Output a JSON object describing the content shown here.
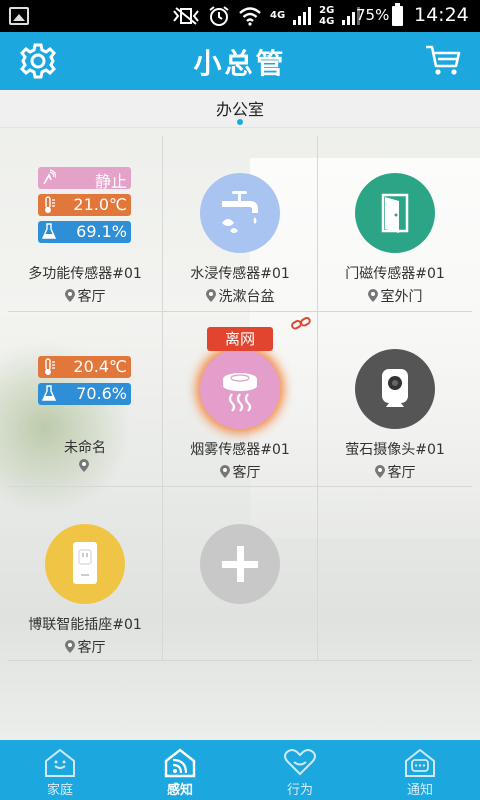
{
  "statusbar": {
    "network_top": "4G",
    "network_bottom": "4G",
    "network2_top": "2G",
    "battery": "75%",
    "time": "14:24"
  },
  "header": {
    "title": "小总管"
  },
  "room": {
    "name": "办公室"
  },
  "devices": [
    {
      "name": "多功能传感器#01",
      "location": "客厅",
      "readings": {
        "motion": "静止",
        "temperature": "21.0℃",
        "humidity": "69.1%"
      }
    },
    {
      "name": "水浸传感器#01",
      "location": "洗漱台盆",
      "icon": "water-faucet-icon",
      "color": "#a9c4f0"
    },
    {
      "name": "门磁传感器#01",
      "location": "室外门",
      "icon": "door-icon",
      "color": "#2ba585"
    },
    {
      "name": "未命名",
      "location": "",
      "readings": {
        "temperature": "20.4℃",
        "humidity": "70.6%"
      }
    },
    {
      "name": "烟雾传感器#01",
      "location": "客厅",
      "icon": "smoke-detector-icon",
      "color": "#e39ecb",
      "status": "离网"
    },
    {
      "name": "萤石摄像头#01",
      "location": "客厅",
      "icon": "camera-icon",
      "color": "#555555"
    },
    {
      "name": "博联智能插座#01",
      "location": "客厅",
      "icon": "smart-plug-icon",
      "color": "#f0c545"
    }
  ],
  "tabs": [
    {
      "label": "家庭",
      "icon": "home-icon"
    },
    {
      "label": "感知",
      "icon": "sensing-icon",
      "active": true
    },
    {
      "label": "行为",
      "icon": "behavior-icon"
    },
    {
      "label": "通知",
      "icon": "notification-icon"
    }
  ]
}
